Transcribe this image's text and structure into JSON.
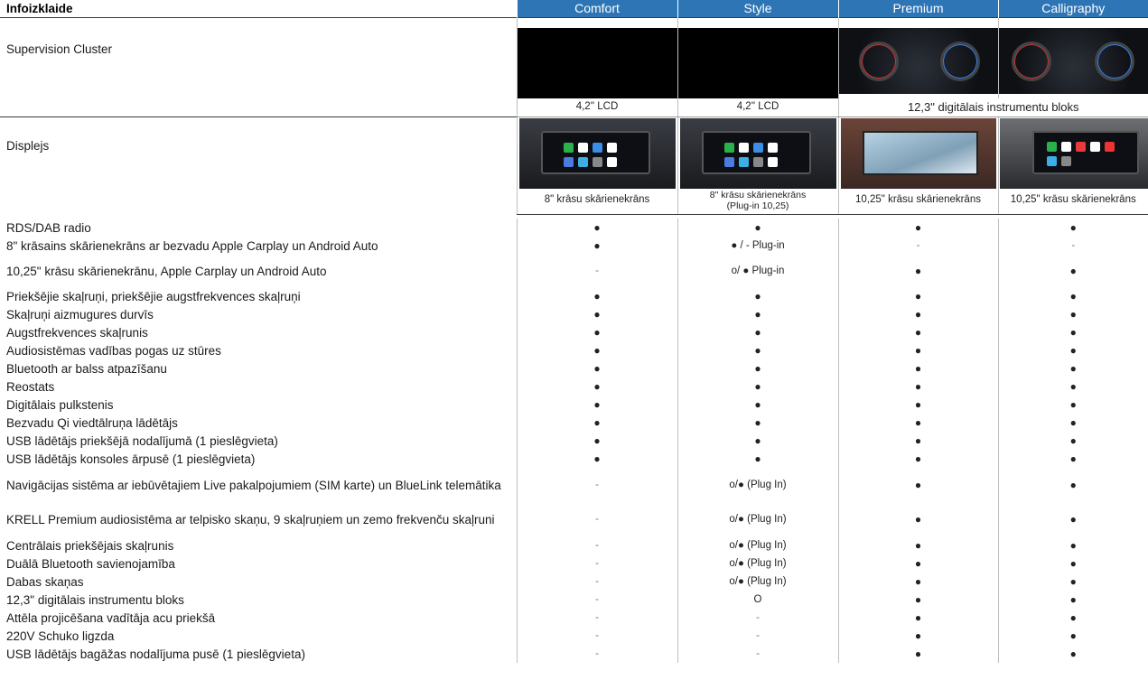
{
  "title": "Infoizklaide",
  "columns": [
    "Comfort",
    "Style",
    "Premium",
    "Calligraphy"
  ],
  "cluster": {
    "label": "Supervision Cluster",
    "captions": [
      "4,2'' LCD",
      "4,2'' LCD",
      "12,3\" digitālais instrumentu bloks"
    ]
  },
  "display": {
    "label": "Displejs",
    "captions": [
      "8\" krāsu skārienekrāns",
      "8\" krāsu skārienekrāns (Plug-in 10,25)",
      "10,25\" krāsu skārienekrāns",
      "10,25\" krāsu skārienekrāns"
    ]
  },
  "rows": [
    {
      "label": "RDS/DAB radio",
      "values": [
        "●",
        "●",
        "●",
        "●"
      ]
    },
    {
      "label": "8\" krāsains skārienekrāns ar bezvadu Apple Carplay un Android Auto",
      "values": [
        "●",
        "● / - Plug-in",
        "-",
        "-"
      ]
    },
    {
      "label": "10,25\" krāsu skārienekrānu, Apple Carplay un Android Auto",
      "values": [
        "-",
        "o/ ● Plug-in",
        "●",
        "●"
      ]
    },
    {
      "label": "Priekšējie skaļruņi, priekšējie augstfrekvences skaļruņi",
      "values": [
        "●",
        "●",
        "●",
        "●"
      ]
    },
    {
      "label": "Skaļruņi aizmugures durvīs",
      "values": [
        "●",
        "●",
        "●",
        "●"
      ]
    },
    {
      "label": "Augstfrekvences skaļrunis",
      "values": [
        "●",
        "●",
        "●",
        "●"
      ]
    },
    {
      "label": "Audiosistēmas vadības pogas uz stūres",
      "values": [
        "●",
        "●",
        "●",
        "●"
      ]
    },
    {
      "label": "Bluetooth ar balss atpazīšanu",
      "values": [
        "●",
        "●",
        "●",
        "●"
      ]
    },
    {
      "label": "Reostats",
      "values": [
        "●",
        "●",
        "●",
        "●"
      ]
    },
    {
      "label": "Digitālais pulkstenis",
      "values": [
        "●",
        "●",
        "●",
        "●"
      ]
    },
    {
      "label": "Bezvadu Qi viedtālruņa lādētājs",
      "values": [
        "●",
        "●",
        "●",
        "●"
      ]
    },
    {
      "label": "USB lādētājs priekšējā nodalījumā (1 pieslēgvieta)",
      "values": [
        "●",
        "●",
        "●",
        "●"
      ]
    },
    {
      "label": "USB lādētājs konsoles ārpusē (1 pieslēgvieta)",
      "values": [
        "●",
        "●",
        "●",
        "●"
      ]
    },
    {
      "label": "Navigācijas sistēma ar iebūvētajiem Live pakalpojumiem (SIM karte) un BlueLink telemātika",
      "values": [
        "-",
        "o/● (Plug In)",
        "●",
        "●"
      ]
    },
    {
      "label": "KRELL Premium audiosistēma ar telpisko skaņu, 9 skaļruņiem un zemo frekvenču skaļruni",
      "values": [
        "-",
        "o/● (Plug In)",
        "●",
        "●"
      ]
    },
    {
      "label": "Centrālais priekšējais skaļrunis",
      "values": [
        "-",
        "o/● (Plug In)",
        "●",
        "●"
      ]
    },
    {
      "label": "Duālā Bluetooth savienojamība",
      "values": [
        "-",
        "o/● (Plug In)",
        "●",
        "●"
      ]
    },
    {
      "label": "Dabas skaņas",
      "values": [
        "-",
        "o/● (Plug In)",
        "●",
        "●"
      ]
    },
    {
      "label": "12,3\" digitālais instrumentu bloks",
      "values": [
        "-",
        "O",
        "●",
        "●"
      ]
    },
    {
      "label": "Attēla projicēšana vadītāja acu priekšā",
      "values": [
        "-",
        "-",
        "●",
        "●"
      ]
    },
    {
      "label": "220V Schuko ligzda",
      "values": [
        "-",
        "-",
        "●",
        "●"
      ]
    },
    {
      "label": "USB lādētājs bagāžas nodalījuma pusē (1 pieslēgvieta)",
      "values": [
        "-",
        "-",
        "●",
        "●"
      ]
    }
  ]
}
